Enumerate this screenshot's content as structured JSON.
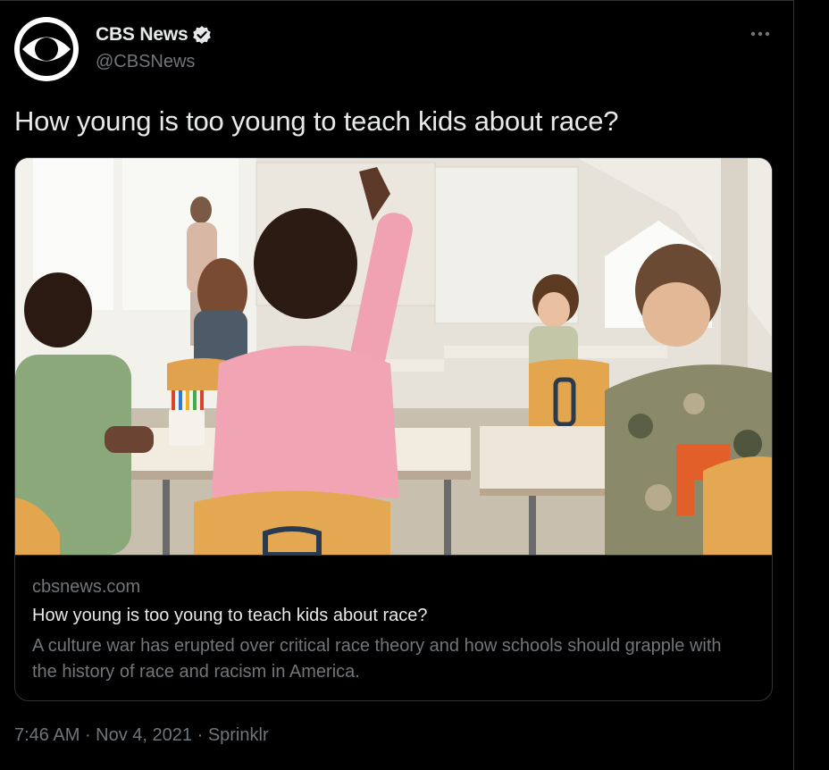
{
  "author": {
    "name": "CBS News",
    "handle": "@CBSNews",
    "verified": true,
    "avatar_icon": "cbs-eye-logo"
  },
  "tweet": {
    "text": "How young is too young to teach kids about race?"
  },
  "card": {
    "domain": "cbsnews.com",
    "title": "How young is too young to teach kids about race?",
    "description": "A culture war has erupted over critical race theory and how schools should grapple with the history of race and racism in America."
  },
  "meta": {
    "time": "7:46 AM",
    "separator1": " · ",
    "date": "Nov 4, 2021",
    "separator2": " · ",
    "source": "Sprinklr"
  },
  "colors": {
    "background": "#000000",
    "text": "#e7e9ea",
    "secondary": "#71767b",
    "border": "#2f3336"
  },
  "icons": {
    "more": "more-dots-icon",
    "verified": "verified-badge-icon"
  }
}
